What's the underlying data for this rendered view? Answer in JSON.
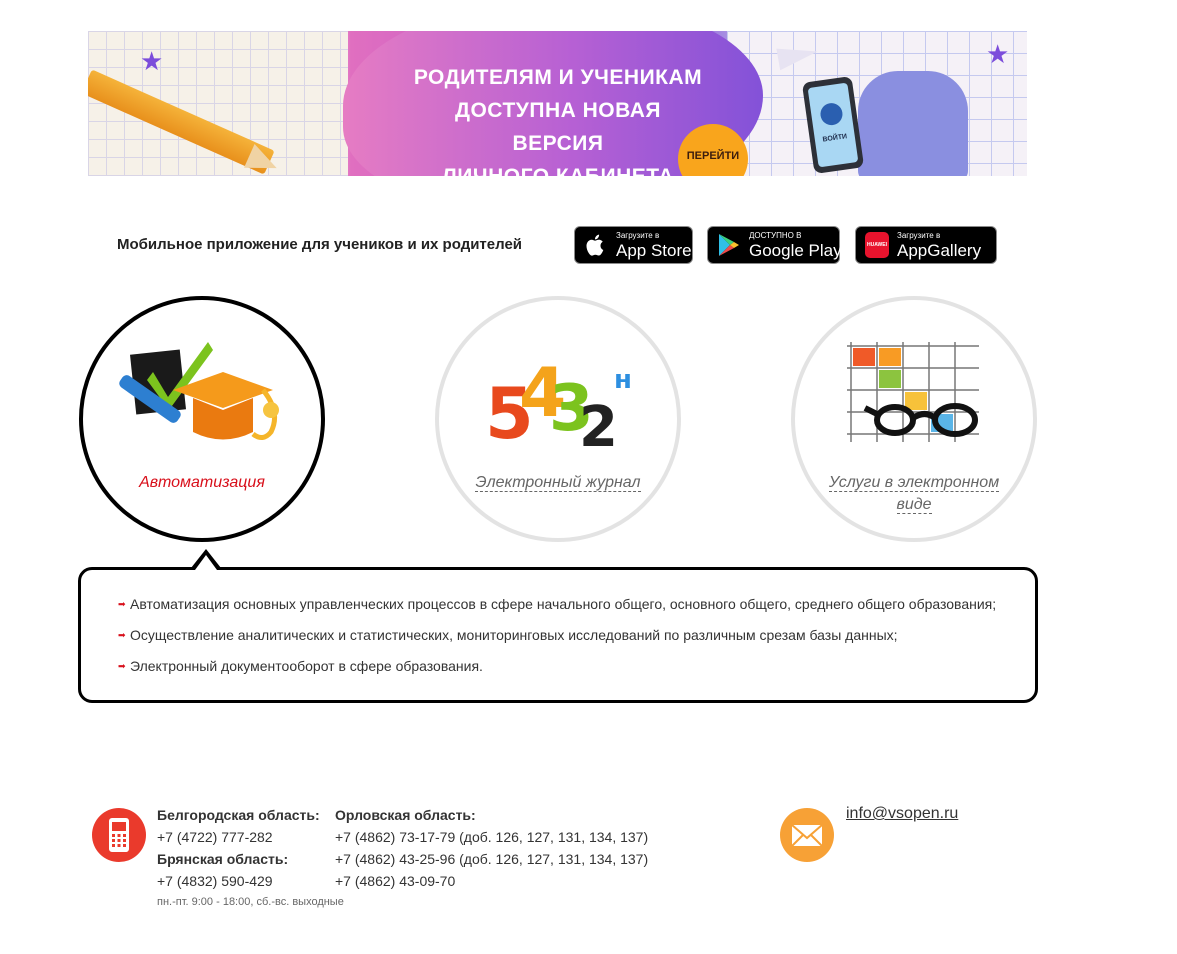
{
  "banner": {
    "title_lines": [
      "Родителям и ученикам",
      "доступна новая версия",
      "личного кабинета"
    ],
    "cta_label": "ПЕРЕЙТИ",
    "phone_label": "ВОЙТИ"
  },
  "apps": {
    "label": "Мобильное приложение для учеников и их родителей",
    "app_store": {
      "small": "Загрузите в",
      "big": "App Store",
      "icon": "apple-icon"
    },
    "google_play": {
      "small": "ДОСТУПНО В",
      "big": "Google Play",
      "icon": "google-play-icon"
    },
    "app_gallery": {
      "small": "Загрузите в",
      "big": "AppGallery",
      "icon": "huawei-icon",
      "logo_text": "HUAWEI"
    }
  },
  "sections": [
    {
      "label": "Автоматизация",
      "icon": "automation-icon",
      "active": true
    },
    {
      "label": "Электронный журнал",
      "icon": "grades-journal-icon",
      "active": false
    },
    {
      "label_line1": "Услуги в электронном",
      "label_line2": "виде",
      "icon": "glasses-schedule-icon",
      "active": false
    }
  ],
  "description": {
    "items": [
      "Автоматизация основных управленческих процессов в сфере начального общего, основного общего, среднего общего образования;",
      "Осуществление аналитических и статистических, мониторинговых исследований по различным срезам базы данных;",
      "Электронный документооборот в сфере образования."
    ]
  },
  "footer": {
    "belgorod_label": "Белгородская область:",
    "belgorod_phone": "+7 (4722) 777-282",
    "bryansk_label": "Брянская область:",
    "bryansk_phone": "+7 (4832) 590-429",
    "orel_label": "Орловская область:",
    "orel_phones": [
      "+7 (4862) 73-17-79 (доб. 126, 127, 131, 134, 137)",
      "+7 (4862) 43-25-96 (доб. 126, 127, 131, 134, 137)",
      "+7 (4862) 43-09-70"
    ],
    "hours": "пн.-пт. 9:00 - 18:00, сб.-вс. выходные",
    "email": "info@vsopen.ru"
  },
  "colors": {
    "accent_red": "#d8101b",
    "phone_icon_bg": "#ea3a2c",
    "mail_icon_bg": "#f7a136"
  }
}
